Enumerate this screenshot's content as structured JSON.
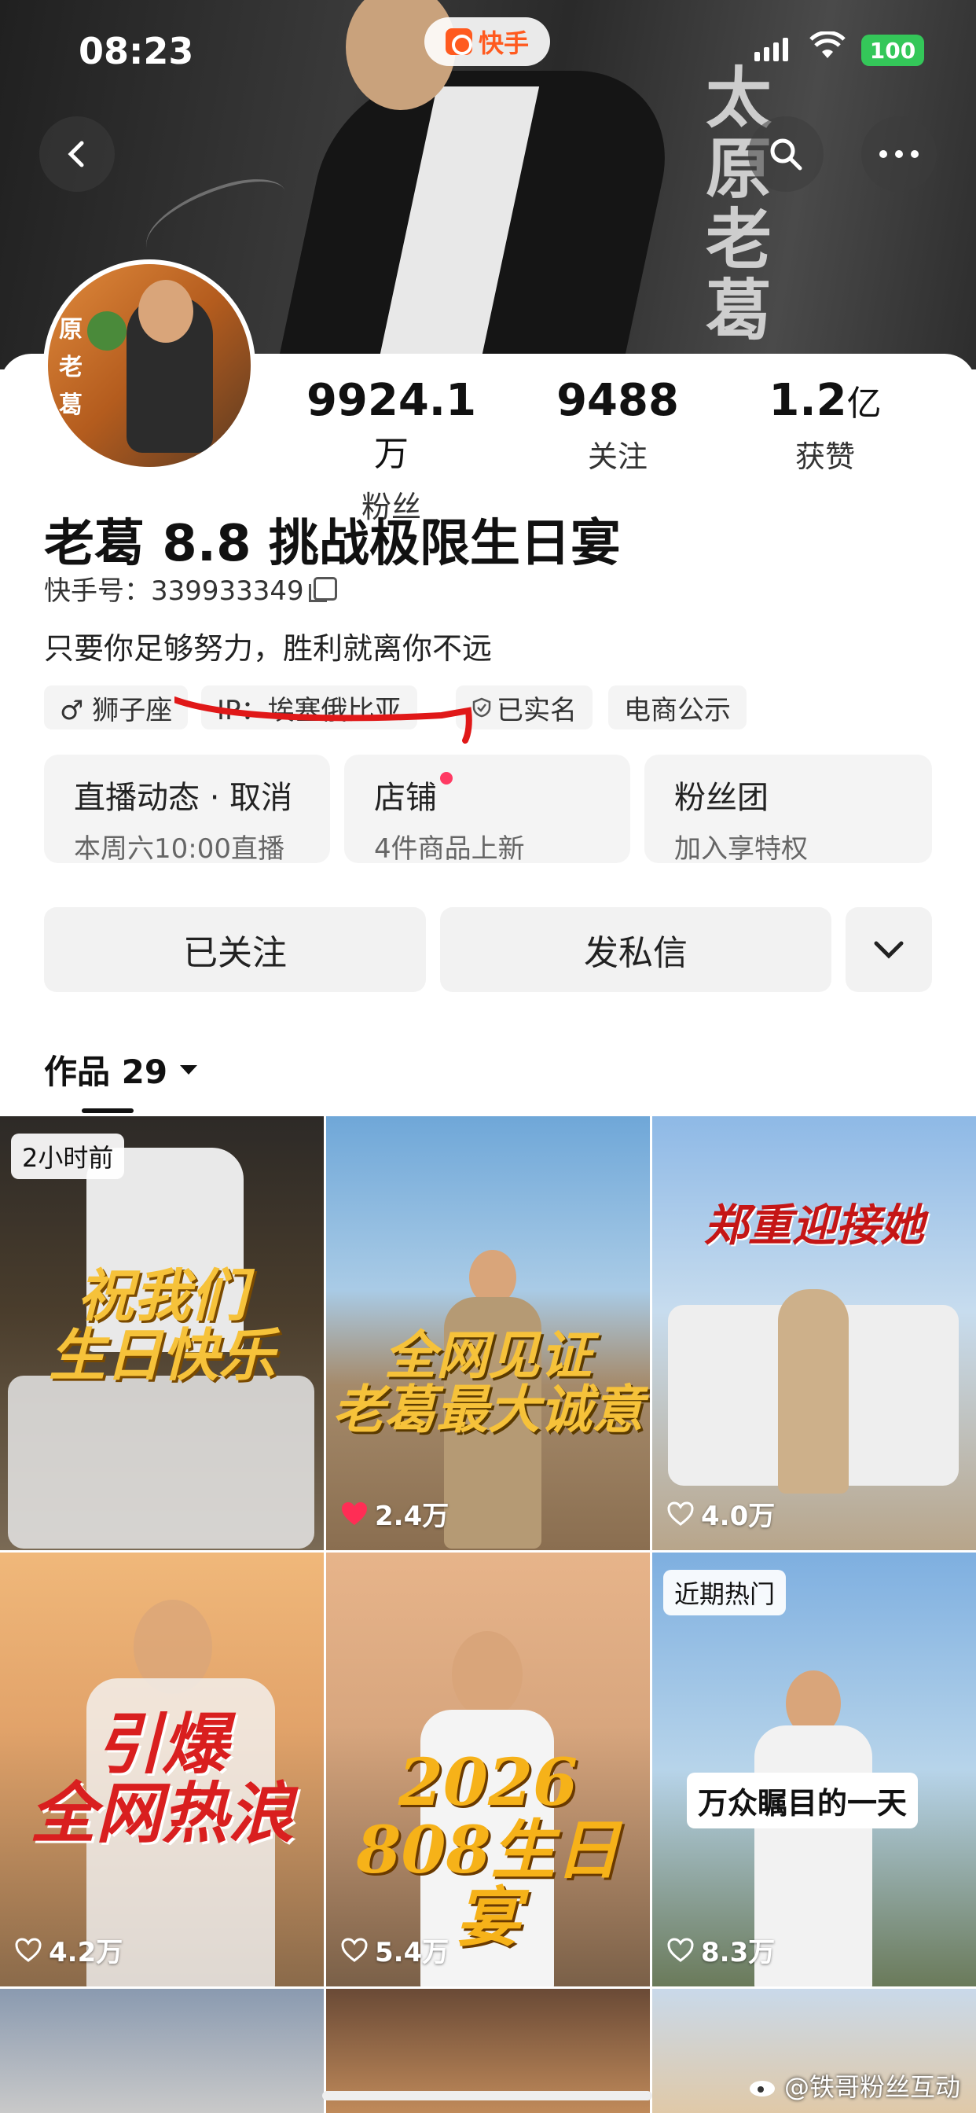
{
  "status_bar": {
    "time": "08:23",
    "battery": "100",
    "app_name": "快手"
  },
  "banner": {
    "side_text": "太原老葛"
  },
  "profile": {
    "stats": [
      {
        "value": "9924.1",
        "unit": "万",
        "label": "粉丝"
      },
      {
        "value": "9488",
        "unit": "",
        "label": "关注"
      },
      {
        "value": "1.2",
        "unit": "亿",
        "label": "获赞"
      }
    ],
    "name": "老葛 8.8 挑战极限生日宴",
    "kuaishou_id": "快手号：339933349",
    "bio": "只要你足够努力，胜利就离你不远",
    "tags": [
      "♂ 狮子座",
      "IP：埃塞俄比亚",
      "已实名",
      "电商公示"
    ],
    "avatar_text": "原老葛"
  },
  "info_cards": [
    {
      "title": "直播动态 · 取消",
      "subtitle": "本周六10:00直播"
    },
    {
      "title": "店铺",
      "subtitle": "4件商品上新"
    },
    {
      "title": "粉丝团",
      "subtitle": "加入享特权"
    }
  ],
  "actions": {
    "follow": "已关注",
    "message": "发私信"
  },
  "works_tab": {
    "label": "作品 29"
  },
  "videos": [
    {
      "badge": "2小时前",
      "overlay": "祝我们\n生日快乐",
      "likes": "",
      "liked": false
    },
    {
      "badge": "",
      "overlay": "全网见证\n老葛最大诚意",
      "likes": "2.4万",
      "liked": true
    },
    {
      "badge": "",
      "overlay": "郑重迎接她",
      "likes": "4.0万",
      "liked": false
    },
    {
      "badge": "",
      "overlay": "引爆\n全网热浪",
      "likes": "4.2万",
      "liked": false
    },
    {
      "badge": "",
      "overlay": "2026\n808生日宴",
      "likes": "5.4万",
      "liked": false
    },
    {
      "badge": "近期热门",
      "overlay": "万众瞩目的一天",
      "likes": "8.3万",
      "liked": false
    }
  ],
  "watermark": "@铁哥粉丝互动",
  "colors": {
    "accent": "#ff5a1f",
    "status_green": "#34c759",
    "like_red": "#ff2d55",
    "shop_dot": "#ff3a63",
    "annotation_red": "#e01818"
  }
}
